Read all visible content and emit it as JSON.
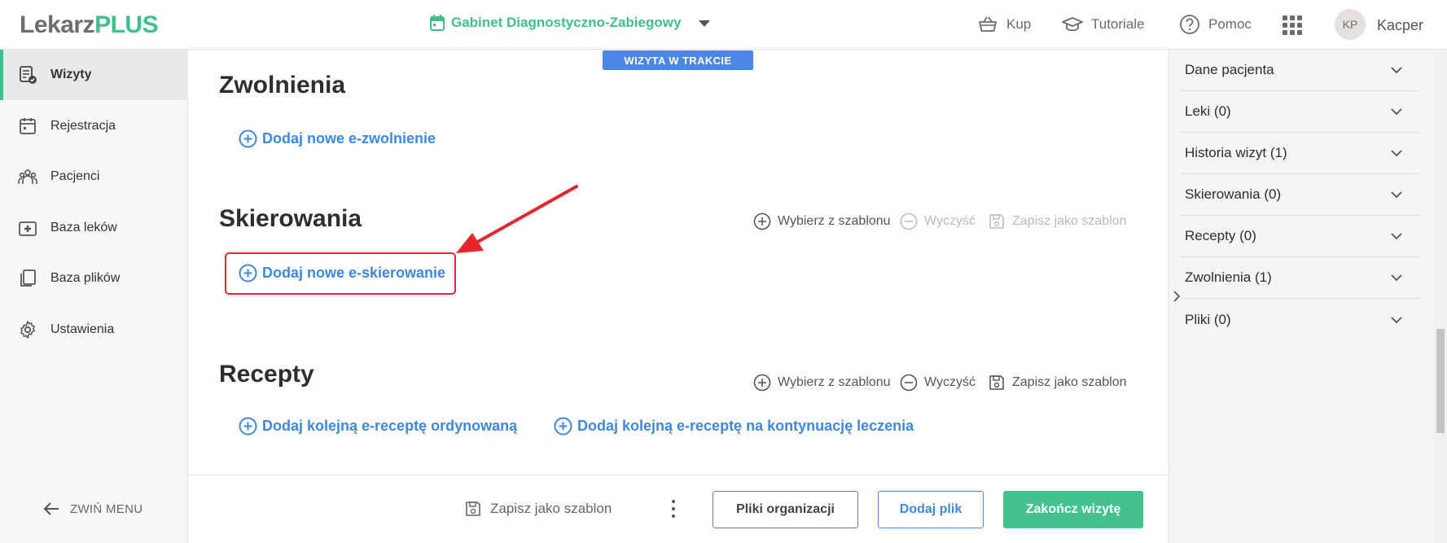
{
  "header": {
    "logo_part1": "Lekarz",
    "logo_part2": "PLUS",
    "clinic": "Gabinet Diagnostyczno-Zabiegowy",
    "nav": {
      "buy": "Kup",
      "tutorials": "Tutoriale",
      "help": "Pomoc"
    },
    "avatar_initials": "KP",
    "username": "Kacper"
  },
  "sidebar": {
    "items": [
      {
        "label": "Wizyty",
        "icon": "visits-icon",
        "active": true
      },
      {
        "label": "Rejestracja",
        "icon": "calendar-icon"
      },
      {
        "label": "Pacjenci",
        "icon": "patients-icon"
      },
      {
        "label": "Baza leków",
        "icon": "medkit-icon"
      },
      {
        "label": "Baza plików",
        "icon": "files-icon"
      },
      {
        "label": "Ustawienia",
        "icon": "gear-icon"
      }
    ],
    "collapse_label": "ZWIŃ MENU"
  },
  "main": {
    "status_badge": "WIZYTA W TRAKCIE",
    "sections": {
      "zwolnienia": {
        "title": "Zwolnienia",
        "add": "Dodaj nowe e-zwolnienie"
      },
      "skierowania": {
        "title": "Skierowania",
        "add": "Dodaj nowe e-skierowanie",
        "tools": {
          "template": "Wybierz z szablonu",
          "clear": "Wyczyść",
          "save": "Zapisz jako szablon"
        }
      },
      "recepty": {
        "title": "Recepty",
        "add_ordinary": "Dodaj kolejną e-receptę ordynowaną",
        "add_continuation": "Dodaj kolejną e-receptę na kontynuację leczenia",
        "tools": {
          "template": "Wybierz z szablonu",
          "clear": "Wyczyść",
          "save": "Zapisz jako szablon"
        }
      }
    }
  },
  "bottombar": {
    "save_template": "Zapisz jako szablon",
    "org_files": "Pliki organizacji",
    "add_file": "Dodaj plik",
    "finish": "Zakończ wizytę"
  },
  "right_panel": {
    "items": [
      "Dane pacjenta",
      "Leki  (0)",
      "Historia wizyt (1)",
      "Skierowania (0)",
      "Recepty (0)",
      "Zwolnienia (1)",
      "Pliki  (0)"
    ]
  },
  "colors": {
    "brand_green": "#3fc18b",
    "link_blue": "#3e87e3",
    "highlight_red": "#e8262a"
  }
}
